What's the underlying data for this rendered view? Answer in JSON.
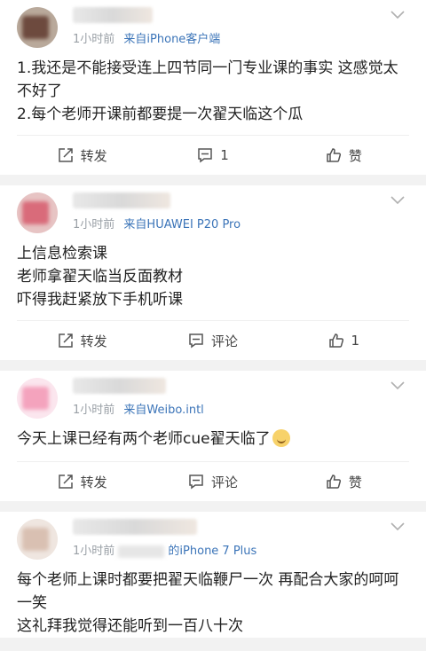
{
  "posts": [
    {
      "time": "1小时前",
      "source": "来自iPhone客户端",
      "lines": [
        "1.我还是不能接受连上四节同一门专业课的事实 这感觉太不好了",
        "2.每个老师开课前都要提一次翟天临这个瓜"
      ],
      "actions": {
        "repost": "转发",
        "comment": "1",
        "like": "赞"
      }
    },
    {
      "time": "1小时前",
      "source": "来自HUAWEI P20 Pro",
      "lines": [
        "上信息检索课",
        "老师拿翟天临当反面教材",
        "吓得我赶紧放下手机听课"
      ],
      "actions": {
        "repost": "转发",
        "comment": "评论",
        "like": "1"
      }
    },
    {
      "time": "1小时前",
      "source": "来自Weibo.intl",
      "lines": [
        "今天上课已经有两个老师cue翟天临了"
      ],
      "actions": {
        "repost": "转发",
        "comment": "评论",
        "like": "赞"
      }
    },
    {
      "time": "1小时前",
      "source": "的iPhone 7 Plus",
      "lines": [
        "每个老师上课时都要把翟天临鞭尸一次 再配合大家的呵呵一笑",
        "这礼拜我觉得还能听到一百八十次"
      ]
    }
  ],
  "icons": {
    "repost": "repost-icon",
    "comment": "comment-icon",
    "like": "thumbs-up-icon",
    "menu": "chevron-down-icon"
  },
  "colors": {
    "source_link": "#3b74b8",
    "meta": "#9aa0a6",
    "background": "#f2f2f2"
  }
}
